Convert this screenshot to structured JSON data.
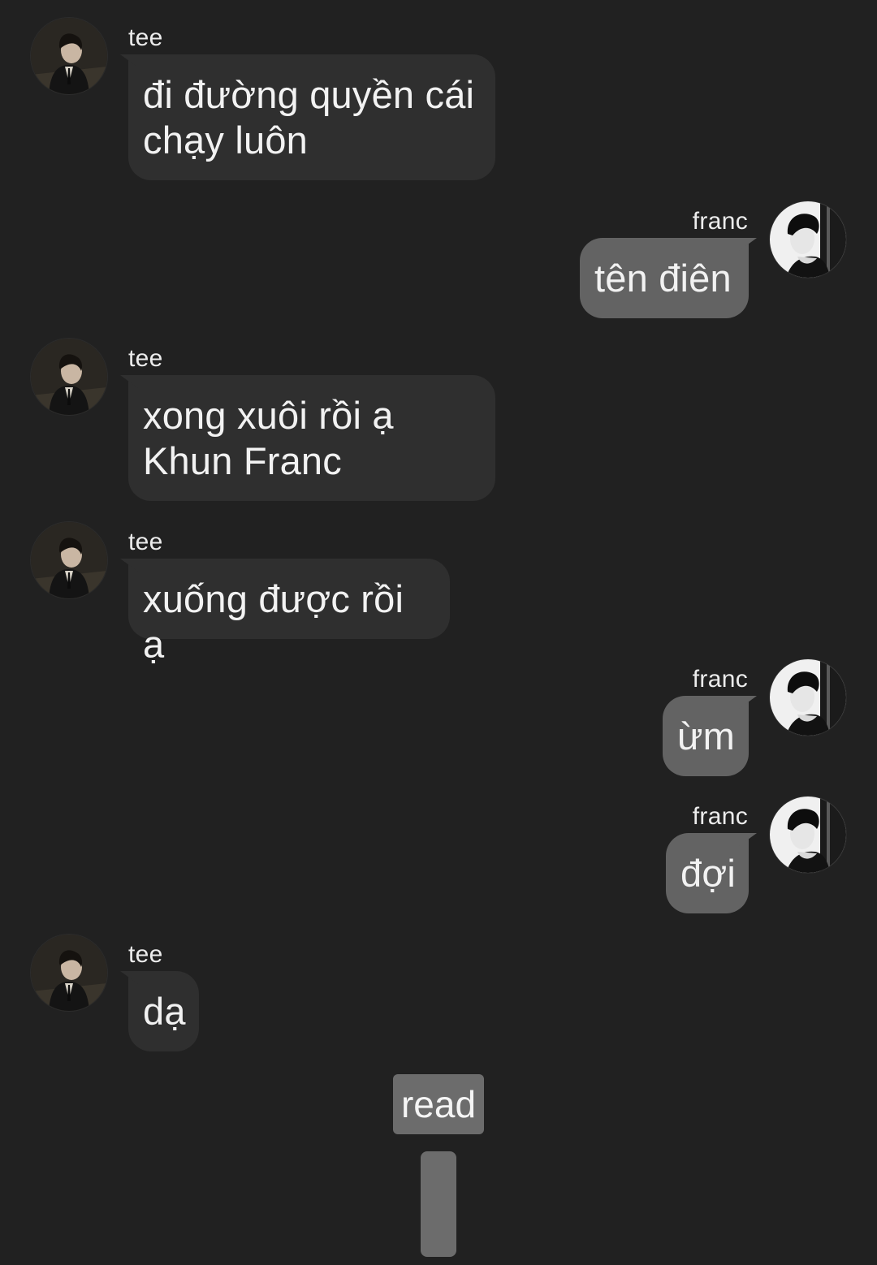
{
  "participants": {
    "left": {
      "name": "tee",
      "avatar_icon": "profile-photo-tee"
    },
    "right": {
      "name": "franc",
      "avatar_icon": "profile-photo-franc"
    }
  },
  "messages": [
    {
      "sender": "tee",
      "text": "đi đường quyền cái\nchạy luôn"
    },
    {
      "sender": "franc",
      "text": "tên điên"
    },
    {
      "sender": "tee",
      "text": "xong xuôi rồi ạ\nKhun Franc"
    },
    {
      "sender": "tee",
      "text": "xuống được rồi ạ"
    },
    {
      "sender": "franc",
      "text": "ừm"
    },
    {
      "sender": "franc",
      "text": "đợi"
    },
    {
      "sender": "tee",
      "text": "dạ"
    }
  ],
  "read_label": "read",
  "colors": {
    "background": "#212121",
    "bubble_left": "#2f2f2f",
    "bubble_right": "#636363",
    "text": "#f2f2f2",
    "badge": "#6c6c6c"
  }
}
